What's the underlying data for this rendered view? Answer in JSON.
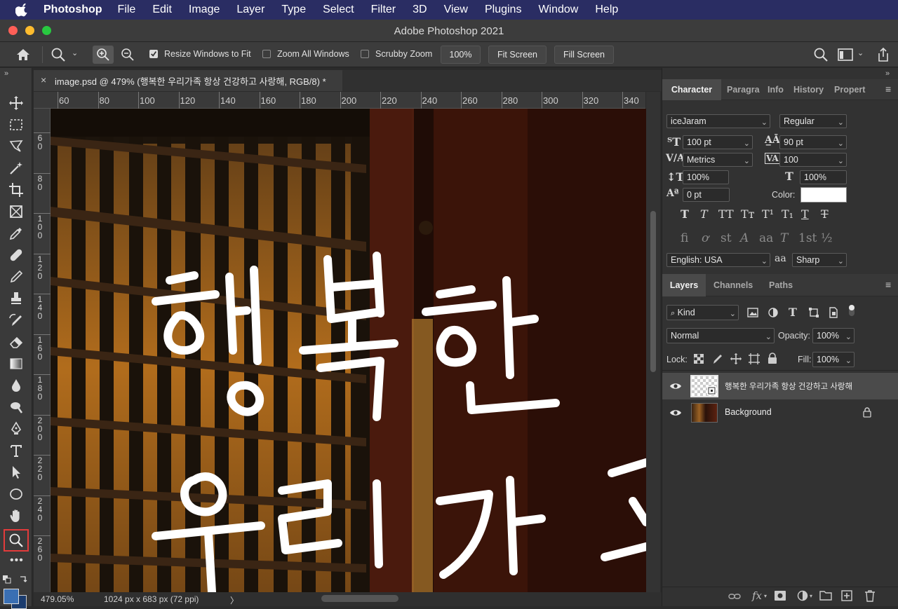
{
  "menubar": {
    "app_name": "Photoshop",
    "items": [
      "File",
      "Edit",
      "Image",
      "Layer",
      "Type",
      "Select",
      "Filter",
      "3D",
      "View",
      "Plugins",
      "Window",
      "Help"
    ]
  },
  "window": {
    "title": "Adobe Photoshop 2021"
  },
  "options_bar": {
    "resize_windows_label": "Resize Windows to Fit",
    "resize_windows_checked": true,
    "zoom_all_label": "Zoom All Windows",
    "zoom_all_checked": false,
    "scrubby_label": "Scrubby Zoom",
    "scrubby_checked": false,
    "zoom_value": "100%",
    "fit_screen_label": "Fit Screen",
    "fill_screen_label": "Fill Screen"
  },
  "document": {
    "tab_title": "image.psd @ 479% (행복한 우리가족 항상 건강하고 사랑해, RGB/8) *",
    "ruler_h_ticks": [
      "60",
      "80",
      "100",
      "120",
      "140",
      "160",
      "180",
      "200",
      "220",
      "240",
      "260",
      "280",
      "300",
      "320",
      "340"
    ],
    "ruler_v_ticks": [
      [
        "6",
        "0"
      ],
      [
        "8",
        "0"
      ],
      [
        "1",
        "0",
        "0"
      ],
      [
        "1",
        "2",
        "0"
      ],
      [
        "1",
        "4",
        "0"
      ],
      [
        "1",
        "6",
        "0"
      ],
      [
        "1",
        "8",
        "0"
      ],
      [
        "2",
        "0",
        "0"
      ],
      [
        "2",
        "2",
        "0"
      ],
      [
        "2",
        "4",
        "0"
      ],
      [
        "2",
        "6",
        "0"
      ]
    ],
    "canvas_text_line1": "행복한",
    "canvas_text_line2": "우리가족"
  },
  "statusbar": {
    "zoom": "479.05%",
    "doc_info": "1024 px x 683 px (72 ppi)",
    "arrow": "〉"
  },
  "character_panel": {
    "tabs": [
      "Character",
      "Paragra",
      "Info",
      "History",
      "Propert"
    ],
    "font_family": "iceJaram",
    "font_style": "Regular",
    "font_size": "100 pt",
    "leading": "90 pt",
    "kerning": "Metrics",
    "tracking": "100",
    "vertical_scale": "100%",
    "horizontal_scale": "100%",
    "baseline_shift": "0 pt",
    "color_label": "Color:",
    "color_value": "#ffffff",
    "language": "English: USA",
    "aa_symbol": "aa",
    "antialias": "Sharp"
  },
  "layers_panel": {
    "tabs": [
      "Layers",
      "Channels",
      "Paths"
    ],
    "filter_kind": "Kind",
    "blend_mode": "Normal",
    "opacity_label": "Opacity:",
    "opacity_value": "100%",
    "lock_label": "Lock:",
    "fill_label": "Fill:",
    "fill_value": "100%",
    "layers": [
      {
        "name": "행복한 우리가족 항상 건강하고 사랑해",
        "selected": true
      },
      {
        "name": "Background",
        "selected": false,
        "locked": true
      }
    ]
  },
  "colors": {
    "menubar_bg": "#2a2d63",
    "accent_highlight": "#e23b3b",
    "foreground_color": "#3a6fb3"
  }
}
